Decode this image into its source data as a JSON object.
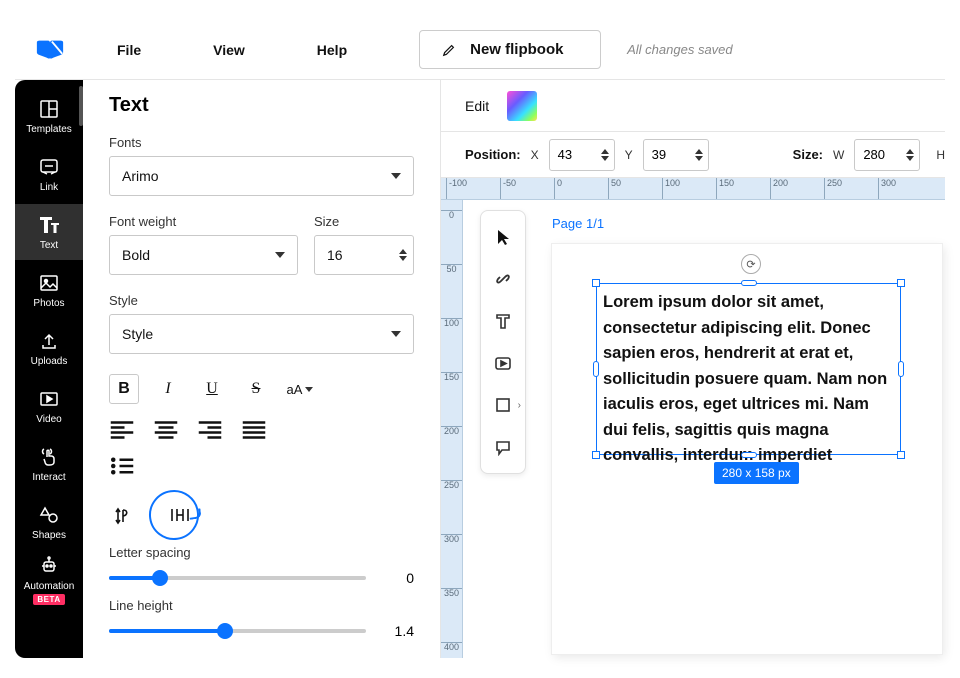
{
  "topbar": {
    "menu": [
      "File",
      "View",
      "Help"
    ],
    "new_flipbook": "New flipbook",
    "save_status": "All changes saved"
  },
  "sidebar": {
    "items": [
      {
        "label": "Templates",
        "icon": "templates-icon"
      },
      {
        "label": "Link",
        "icon": "link-icon"
      },
      {
        "label": "Text",
        "icon": "text-icon",
        "active": true
      },
      {
        "label": "Photos",
        "icon": "photos-icon"
      },
      {
        "label": "Uploads",
        "icon": "uploads-icon"
      },
      {
        "label": "Video",
        "icon": "video-icon"
      },
      {
        "label": "Interact",
        "icon": "interact-icon"
      },
      {
        "label": "Shapes",
        "icon": "shapes-icon"
      },
      {
        "label": "Automation",
        "icon": "automation-icon"
      }
    ],
    "beta_label": "BETA"
  },
  "panel": {
    "title": "Text",
    "fonts_label": "Fonts",
    "font_value": "Arimo",
    "font_weight_label": "Font weight",
    "font_weight_value": "Bold",
    "size_label": "Size",
    "size_value": "16",
    "style_label": "Style",
    "style_value": "Style",
    "format": {
      "bold": "B",
      "italic": "I",
      "underline": "U",
      "strike": "S",
      "case": "aA"
    },
    "letter_spacing_label": "Letter spacing",
    "letter_spacing_value": "0",
    "line_height_label": "Line height",
    "line_height_value": "1.4"
  },
  "editbar": {
    "label": "Edit"
  },
  "posbar": {
    "position_label": "Position:",
    "x_label": "X",
    "x_value": "43",
    "y_label": "Y",
    "y_value": "39",
    "size_label": "Size:",
    "w_label": "W",
    "w_value": "280",
    "h_label": "H"
  },
  "ruler_h": [
    {
      "pos": 5,
      "label": "-100"
    },
    {
      "pos": 59,
      "label": "-50"
    },
    {
      "pos": 113,
      "label": "0"
    },
    {
      "pos": 167,
      "label": "50"
    },
    {
      "pos": 221,
      "label": "100"
    },
    {
      "pos": 275,
      "label": "150"
    },
    {
      "pos": 329,
      "label": "200"
    },
    {
      "pos": 383,
      "label": "250"
    },
    {
      "pos": 437,
      "label": "300"
    }
  ],
  "ruler_v": [
    {
      "pos": 10,
      "label": "0"
    },
    {
      "pos": 64,
      "label": "50"
    },
    {
      "pos": 118,
      "label": "100"
    },
    {
      "pos": 172,
      "label": "150"
    },
    {
      "pos": 226,
      "label": "200"
    },
    {
      "pos": 280,
      "label": "250"
    },
    {
      "pos": 334,
      "label": "300"
    },
    {
      "pos": 388,
      "label": "350"
    },
    {
      "pos": 442,
      "label": "400"
    }
  ],
  "canvas": {
    "page_label": "Page 1/1",
    "text_content": "Lorem ipsum dolor sit amet, consectetur adipiscing elit. Donec sapien eros, hendrerit at erat et, sollicitudin posuere quam. Nam non iaculis eros, eget ultrices mi. Nam dui felis, sagittis quis magna convallis, interdum imperdiet",
    "dimensions_badge": "280 x 158 px"
  }
}
